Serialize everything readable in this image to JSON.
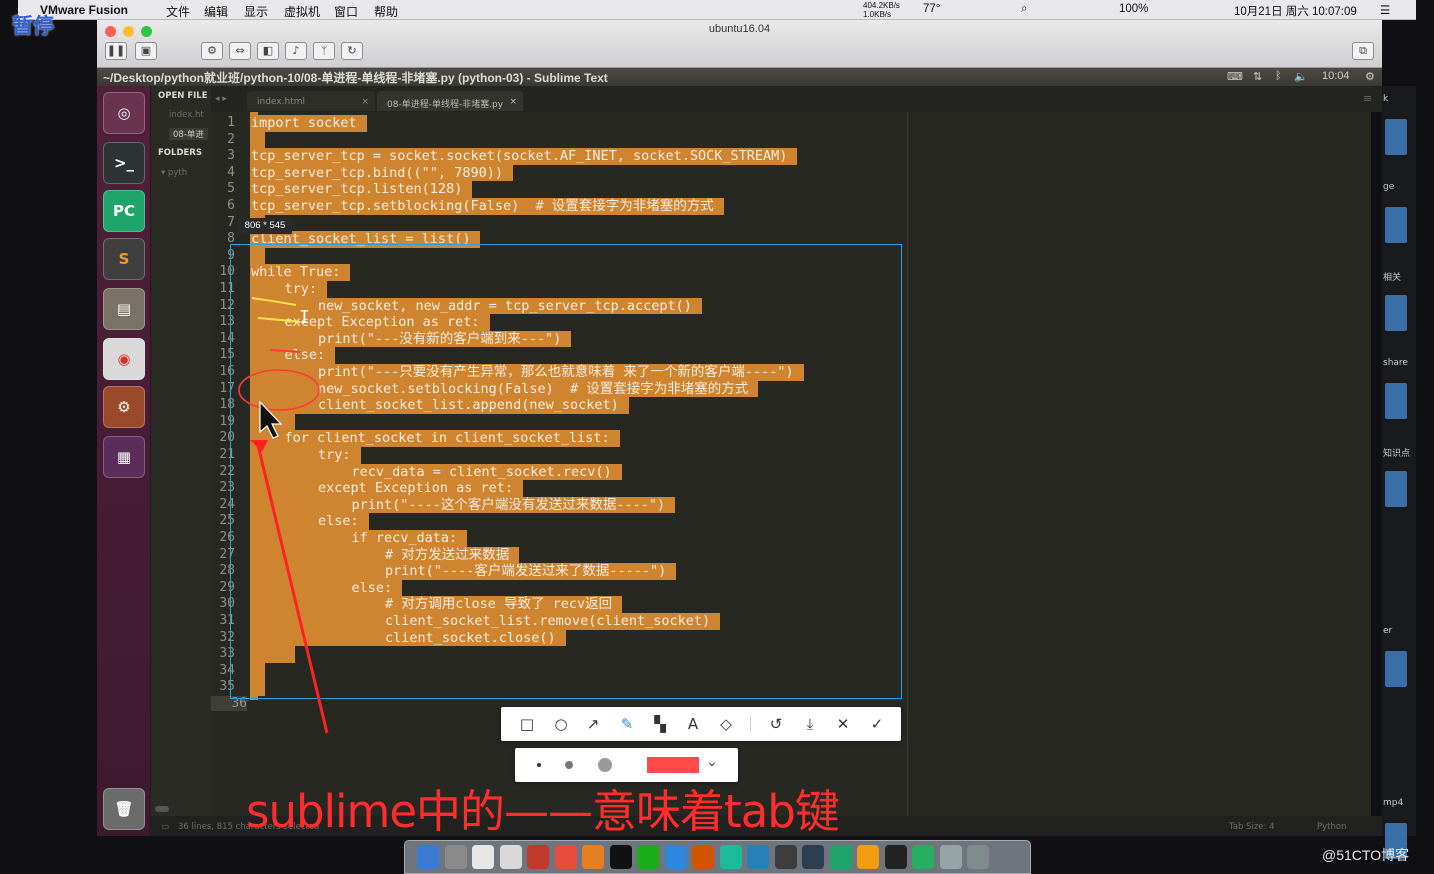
{
  "mac_menubar": {
    "app": "VMware Fusion",
    "menus": [
      "文件",
      "编辑",
      "显示",
      "虚拟机",
      "窗口",
      "帮助"
    ],
    "net_up": "404.2KB/s",
    "net_down": "1.0KB/s",
    "temp": "77°",
    "battery": "100%",
    "datetime": "10月21日 周六  10:07:09"
  },
  "paused_label": "暂停",
  "vmware": {
    "title": "ubuntu16.04"
  },
  "ubuntu_bar": {
    "title": "~/Desktop/python就业班/python-10/08-单进程-单线程-非堵塞.py (python-03) - Sublime Text",
    "clock": "10:04"
  },
  "sidebar": {
    "open_files": "OPEN FILE",
    "files": [
      "index.ht",
      "08-单进"
    ],
    "folders": "FOLDERS",
    "folder": "pyth"
  },
  "tabs": [
    {
      "label": "index.html",
      "close": "×"
    },
    {
      "label": "08-单进程-单线程-非堵塞.py",
      "close": "×"
    }
  ],
  "code_lines": [
    {
      "n": "1",
      "text": "import socket",
      "indent": 0
    },
    {
      "n": "2",
      "text": "",
      "indent": 0
    },
    {
      "n": "3",
      "text": "tcp_server_tcp = socket.socket(socket.AF_INET, socket.SOCK_STREAM)",
      "indent": 0
    },
    {
      "n": "4",
      "text": "tcp_server_tcp.bind((\"\", 7890))",
      "indent": 0
    },
    {
      "n": "5",
      "text": "tcp_server_tcp.listen(128)",
      "indent": 0
    },
    {
      "n": "6",
      "text": "tcp_server_tcp.setblocking(False)  # 设置套接字为非堵塞的方式",
      "indent": 0
    },
    {
      "n": "7",
      "text": "",
      "indent": 0
    },
    {
      "n": "8",
      "text": "client_socket_list = list()",
      "indent": 0
    },
    {
      "n": "9",
      "text": "",
      "indent": 0
    },
    {
      "n": "10",
      "text": "while True:",
      "indent": 0
    },
    {
      "n": "11",
      "text": "try:",
      "indent": 1
    },
    {
      "n": "12",
      "text": "new_socket, new_addr = tcp_server_tcp.accept()",
      "indent": 2
    },
    {
      "n": "13",
      "text": "except Exception as ret:",
      "indent": 1
    },
    {
      "n": "14",
      "text": "print(\"---没有新的客户端到来---\")",
      "indent": 2
    },
    {
      "n": "15",
      "text": "else:",
      "indent": 1
    },
    {
      "n": "16",
      "text": "print(\"---只要没有产生异常，那么也就意味着 来了一个新的客户端----\")",
      "indent": 2
    },
    {
      "n": "17",
      "text": "new_socket.setblocking(False)  # 设置套接字为非堵塞的方式",
      "indent": 2
    },
    {
      "n": "18",
      "text": "client_socket_list.append(new_socket)",
      "indent": 2
    },
    {
      "n": "19",
      "text": "",
      "indent": 1
    },
    {
      "n": "20",
      "text": "for client_socket in client_socket_list:",
      "indent": 1
    },
    {
      "n": "21",
      "text": "try:",
      "indent": 2
    },
    {
      "n": "22",
      "text": "recv_data = client_socket.recv()",
      "indent": 3
    },
    {
      "n": "23",
      "text": "except Exception as ret:",
      "indent": 2
    },
    {
      "n": "24",
      "text": "print(\"----这个客户端没有发送过来数据----\")",
      "indent": 3
    },
    {
      "n": "25",
      "text": "else:",
      "indent": 2
    },
    {
      "n": "26",
      "text": "if recv_data:",
      "indent": 3
    },
    {
      "n": "27",
      "text": "# 对方发送过来数据",
      "indent": 4
    },
    {
      "n": "28",
      "text": "print(\"----客户端发送过来了数据-----\")",
      "indent": 4
    },
    {
      "n": "29",
      "text": "else:",
      "indent": 3
    },
    {
      "n": "30",
      "text": "# 对方调用close 导致了 recv返回",
      "indent": 4
    },
    {
      "n": "31",
      "text": "client_socket_list.remove(client_socket)",
      "indent": 4
    },
    {
      "n": "32",
      "text": "client_socket.close()",
      "indent": 4
    },
    {
      "n": "33",
      "text": "",
      "indent": 1
    },
    {
      "n": "34",
      "text": "",
      "indent": 0
    },
    {
      "n": "35",
      "text": "",
      "indent": 0
    },
    {
      "n": "36",
      "text": "",
      "indent": 0
    }
  ],
  "selection_size": "806 * 545",
  "status": {
    "left": "36 lines, 815 characters selected",
    "tab_size": "Tab Size: 4",
    "syntax": "Python"
  },
  "right_strip": [
    "k",
    "ge",
    "相关",
    "share",
    "知识点",
    "er",
    "mp4"
  ],
  "screenshot_toolbar": {
    "tools": [
      "rectangle-tool",
      "ellipse-tool",
      "arrow-tool",
      "pen-tool",
      "mosaic-tool",
      "text-tool",
      "tag-tool",
      "undo",
      "download",
      "close",
      "confirm"
    ],
    "brush_color": "#ff4a4a"
  },
  "caption": "sublime中的——意味着tab键",
  "watermark": "@51CTO博客",
  "colors": {
    "selection": "#cf8430",
    "editor_bg": "#272822",
    "annotation": "#ff2d2d",
    "box": "#25a3e5"
  }
}
